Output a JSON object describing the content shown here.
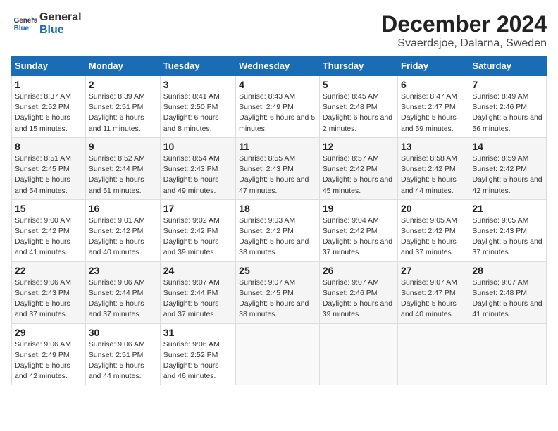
{
  "logo": {
    "line1": "General",
    "line2": "Blue"
  },
  "title": "December 2024",
  "subtitle": "Svaerdsjoe, Dalarna, Sweden",
  "days_of_week": [
    "Sunday",
    "Monday",
    "Tuesday",
    "Wednesday",
    "Thursday",
    "Friday",
    "Saturday"
  ],
  "weeks": [
    [
      {
        "day": 1,
        "sunrise": "8:37 AM",
        "sunset": "2:52 PM",
        "daylight": "6 hours and 15 minutes."
      },
      {
        "day": 2,
        "sunrise": "8:39 AM",
        "sunset": "2:51 PM",
        "daylight": "6 hours and 11 minutes."
      },
      {
        "day": 3,
        "sunrise": "8:41 AM",
        "sunset": "2:50 PM",
        "daylight": "6 hours and 8 minutes."
      },
      {
        "day": 4,
        "sunrise": "8:43 AM",
        "sunset": "2:49 PM",
        "daylight": "6 hours and 5 minutes."
      },
      {
        "day": 5,
        "sunrise": "8:45 AM",
        "sunset": "2:48 PM",
        "daylight": "6 hours and 2 minutes."
      },
      {
        "day": 6,
        "sunrise": "8:47 AM",
        "sunset": "2:47 PM",
        "daylight": "5 hours and 59 minutes."
      },
      {
        "day": 7,
        "sunrise": "8:49 AM",
        "sunset": "2:46 PM",
        "daylight": "5 hours and 56 minutes."
      }
    ],
    [
      {
        "day": 8,
        "sunrise": "8:51 AM",
        "sunset": "2:45 PM",
        "daylight": "5 hours and 54 minutes."
      },
      {
        "day": 9,
        "sunrise": "8:52 AM",
        "sunset": "2:44 PM",
        "daylight": "5 hours and 51 minutes."
      },
      {
        "day": 10,
        "sunrise": "8:54 AM",
        "sunset": "2:43 PM",
        "daylight": "5 hours and 49 minutes."
      },
      {
        "day": 11,
        "sunrise": "8:55 AM",
        "sunset": "2:43 PM",
        "daylight": "5 hours and 47 minutes."
      },
      {
        "day": 12,
        "sunrise": "8:57 AM",
        "sunset": "2:42 PM",
        "daylight": "5 hours and 45 minutes."
      },
      {
        "day": 13,
        "sunrise": "8:58 AM",
        "sunset": "2:42 PM",
        "daylight": "5 hours and 44 minutes."
      },
      {
        "day": 14,
        "sunrise": "8:59 AM",
        "sunset": "2:42 PM",
        "daylight": "5 hours and 42 minutes."
      }
    ],
    [
      {
        "day": 15,
        "sunrise": "9:00 AM",
        "sunset": "2:42 PM",
        "daylight": "5 hours and 41 minutes."
      },
      {
        "day": 16,
        "sunrise": "9:01 AM",
        "sunset": "2:42 PM",
        "daylight": "5 hours and 40 minutes."
      },
      {
        "day": 17,
        "sunrise": "9:02 AM",
        "sunset": "2:42 PM",
        "daylight": "5 hours and 39 minutes."
      },
      {
        "day": 18,
        "sunrise": "9:03 AM",
        "sunset": "2:42 PM",
        "daylight": "5 hours and 38 minutes."
      },
      {
        "day": 19,
        "sunrise": "9:04 AM",
        "sunset": "2:42 PM",
        "daylight": "5 hours and 37 minutes."
      },
      {
        "day": 20,
        "sunrise": "9:05 AM",
        "sunset": "2:42 PM",
        "daylight": "5 hours and 37 minutes."
      },
      {
        "day": 21,
        "sunrise": "9:05 AM",
        "sunset": "2:43 PM",
        "daylight": "5 hours and 37 minutes."
      }
    ],
    [
      {
        "day": 22,
        "sunrise": "9:06 AM",
        "sunset": "2:43 PM",
        "daylight": "5 hours and 37 minutes."
      },
      {
        "day": 23,
        "sunrise": "9:06 AM",
        "sunset": "2:44 PM",
        "daylight": "5 hours and 37 minutes."
      },
      {
        "day": 24,
        "sunrise": "9:07 AM",
        "sunset": "2:44 PM",
        "daylight": "5 hours and 37 minutes."
      },
      {
        "day": 25,
        "sunrise": "9:07 AM",
        "sunset": "2:45 PM",
        "daylight": "5 hours and 38 minutes."
      },
      {
        "day": 26,
        "sunrise": "9:07 AM",
        "sunset": "2:46 PM",
        "daylight": "5 hours and 39 minutes."
      },
      {
        "day": 27,
        "sunrise": "9:07 AM",
        "sunset": "2:47 PM",
        "daylight": "5 hours and 40 minutes."
      },
      {
        "day": 28,
        "sunrise": "9:07 AM",
        "sunset": "2:48 PM",
        "daylight": "5 hours and 41 minutes."
      }
    ],
    [
      {
        "day": 29,
        "sunrise": "9:06 AM",
        "sunset": "2:49 PM",
        "daylight": "5 hours and 42 minutes."
      },
      {
        "day": 30,
        "sunrise": "9:06 AM",
        "sunset": "2:51 PM",
        "daylight": "5 hours and 44 minutes."
      },
      {
        "day": 31,
        "sunrise": "9:06 AM",
        "sunset": "2:52 PM",
        "daylight": "5 hours and 46 minutes."
      },
      null,
      null,
      null,
      null
    ]
  ]
}
